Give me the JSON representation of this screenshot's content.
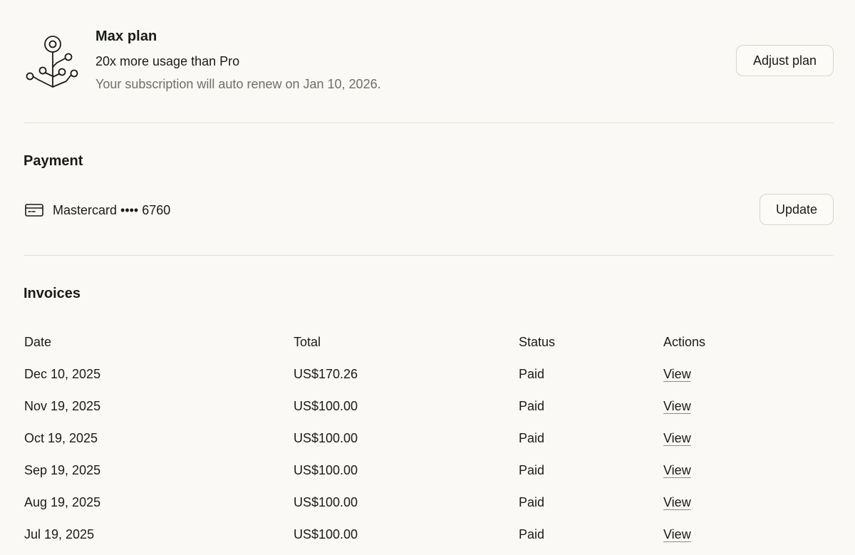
{
  "plan": {
    "icon": "plan-tree-icon",
    "name": "Max plan",
    "description": "20x more usage than Pro",
    "renewal": "Your subscription will auto renew on Jan 10, 2026.",
    "adjust_label": "Adjust plan"
  },
  "payment": {
    "title": "Payment",
    "card_icon": "credit-card-icon",
    "card_text": "Mastercard •••• 6760",
    "update_label": "Update"
  },
  "invoices": {
    "title": "Invoices",
    "columns": [
      "Date",
      "Total",
      "Status",
      "Actions"
    ],
    "rows": [
      {
        "date": "Dec 10, 2025",
        "total": "US$170.26",
        "status": "Paid",
        "action": "View"
      },
      {
        "date": "Nov 19, 2025",
        "total": "US$100.00",
        "status": "Paid",
        "action": "View"
      },
      {
        "date": "Oct 19, 2025",
        "total": "US$100.00",
        "status": "Paid",
        "action": "View"
      },
      {
        "date": "Sep 19, 2025",
        "total": "US$100.00",
        "status": "Paid",
        "action": "View"
      },
      {
        "date": "Aug 19, 2025",
        "total": "US$100.00",
        "status": "Paid",
        "action": "View"
      },
      {
        "date": "Jul 19, 2025",
        "total": "US$100.00",
        "status": "Paid",
        "action": "View"
      }
    ]
  }
}
